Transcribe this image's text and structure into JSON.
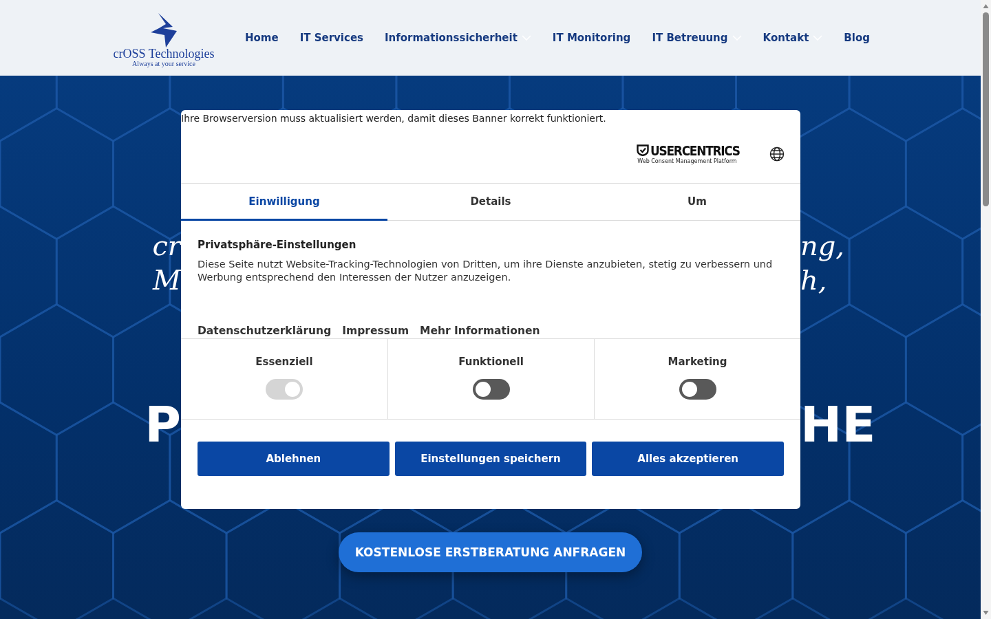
{
  "logo": {
    "name": "crOSS Technologies",
    "tagline": "Always at your service"
  },
  "nav": [
    {
      "label": "Home",
      "dropdown": false
    },
    {
      "label": "IT Services",
      "dropdown": false
    },
    {
      "label": "Informationssicherheit",
      "dropdown": true
    },
    {
      "label": "IT Monitoring",
      "dropdown": false
    },
    {
      "label": "IT Betreuung",
      "dropdown": true
    },
    {
      "label": "Kontakt",
      "dropdown": true
    },
    {
      "label": "Blog",
      "dropdown": false
    }
  ],
  "hero": {
    "lines": [
      {
        "left": "cr",
        "right": "ng,"
      },
      {
        "left": "M",
        "right": "h,"
      }
    ],
    "headline": {
      "left": "P",
      "right": "HE"
    },
    "cta": "KOSTENLOSE ERSTBERATUNG ANFRAGEN"
  },
  "consent": {
    "notice": "Ihre Browserversion muss aktualisiert werden, damit dieses Banner korrekt funktioniert.",
    "brand": {
      "name": "USERCENTRICS",
      "tagline": "Web Consent Management Platform"
    },
    "tabs": [
      {
        "label": "Einwilligung",
        "selected": true
      },
      {
        "label": "Details",
        "selected": false
      },
      {
        "label": "Um",
        "selected": false
      }
    ],
    "title": "Privatsphäre-Einstellungen",
    "text": "Diese Seite nutzt Website-Tracking-Technologien von Dritten, um ihre Dienste anzubieten, stetig zu verbessern und Werbung entsprechend den Interessen der Nutzer anzuzeigen.",
    "links": [
      "Datenschutzerklärung",
      "Impressum",
      "Mehr Informationen"
    ],
    "categories": [
      {
        "label": "Essenziell",
        "checked": true,
        "disabled": true
      },
      {
        "label": "Funktionell",
        "checked": false,
        "disabled": false
      },
      {
        "label": "Marketing",
        "checked": false,
        "disabled": false
      }
    ],
    "buttons": [
      "Ablehnen",
      "Einstellungen speichern",
      "Alles akzeptieren"
    ]
  }
}
